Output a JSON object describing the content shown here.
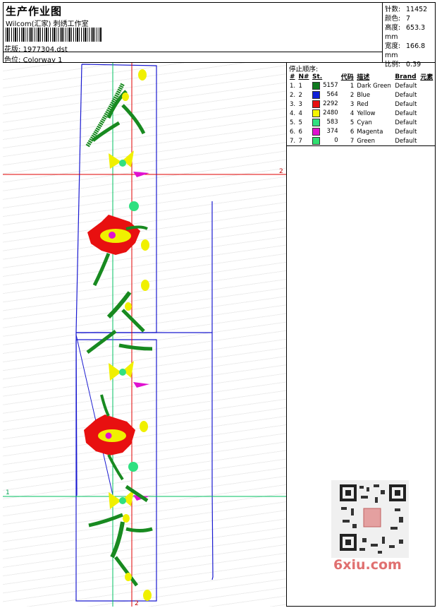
{
  "header": {
    "title": "生产作业图",
    "company": "Wilcom(汇家) 刺绣工作室",
    "design_label": "花版:",
    "design_value": "1977304.dst",
    "colorway_label": "色位:",
    "colorway_value": "Colorway 1"
  },
  "stats": [
    {
      "label": "针数:",
      "value": "11452"
    },
    {
      "label": "颜色:",
      "value": "7"
    },
    {
      "label": "高度:",
      "value": "653.3 mm"
    },
    {
      "label": "宽度:",
      "value": "166.8 mm"
    },
    {
      "label": "比例:",
      "value": "0.39"
    }
  ],
  "sequence": {
    "title": "停止顺序:",
    "columns": [
      "#",
      "N#",
      "St.",
      "代码",
      "描述",
      "Brand",
      "元素"
    ],
    "rows": [
      {
        "idx": "1.",
        "n": "1",
        "color": "#0f7a1f",
        "st": "5157",
        "code": "1",
        "desc": "Dark Green",
        "brand": "Default"
      },
      {
        "idx": "2.",
        "n": "2",
        "color": "#1020d8",
        "st": "564",
        "code": "2",
        "desc": "Blue",
        "brand": "Default"
      },
      {
        "idx": "3.",
        "n": "3",
        "color": "#e81010",
        "st": "2292",
        "code": "3",
        "desc": "Red",
        "brand": "Default"
      },
      {
        "idx": "4.",
        "n": "4",
        "color": "#f4f400",
        "st": "2480",
        "code": "4",
        "desc": "Yellow",
        "brand": "Default"
      },
      {
        "idx": "5.",
        "n": "5",
        "color": "#30e080",
        "st": "583",
        "code": "5",
        "desc": "Cyan",
        "brand": "Default"
      },
      {
        "idx": "6.",
        "n": "6",
        "color": "#e010d0",
        "st": "374",
        "code": "6",
        "desc": "Magenta",
        "brand": "Default"
      },
      {
        "idx": "7.",
        "n": "7",
        "color": "#30e070",
        "st": "0",
        "code": "7",
        "desc": "Green",
        "brand": "Default"
      }
    ]
  },
  "canvas": {
    "marker_1": "1",
    "marker_2": "2",
    "marker_2b": "2"
  },
  "watermark": {
    "site": "6xiu.com"
  }
}
